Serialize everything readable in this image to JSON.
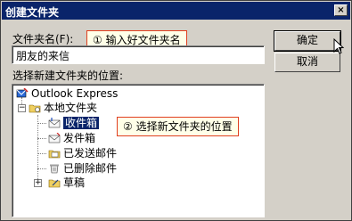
{
  "dialog": {
    "title": "创建文件夹",
    "close_glyph": "×",
    "name_label": "文件夹名(F):",
    "name_value": "朋友的来信",
    "location_label": "选择新建文件夹的位置:",
    "ok_label": "确定",
    "cancel_label": "取消"
  },
  "callouts": {
    "step1": "① 输入好文件夹名",
    "step2": "② 选择新文件夹的位置"
  },
  "tree": {
    "root": "Outlook Express",
    "local": "本地文件夹",
    "items": [
      "收件箱",
      "发件箱",
      "已发送邮件",
      "已删除邮件",
      "草稿"
    ],
    "selected": "收件箱"
  },
  "icons": {
    "root": "outlook-express-icon",
    "local": "local-folders-icon",
    "inbox": "inbox-icon",
    "outbox": "outbox-icon",
    "sent": "sent-items-icon",
    "deleted": "deleted-items-icon",
    "drafts": "drafts-icon"
  },
  "colors": {
    "title_bar": "#0a246a",
    "selection": "#0a246a",
    "callout_border": "#e04020",
    "face": "#d4d0c8"
  }
}
